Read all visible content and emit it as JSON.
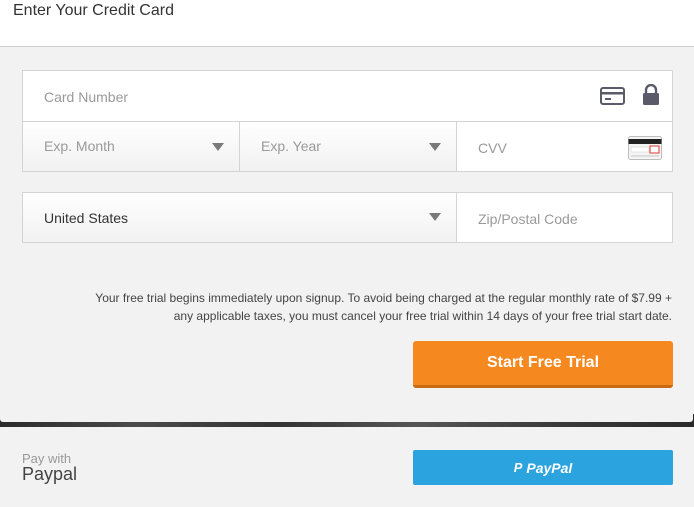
{
  "header": {
    "title": "Enter Your Credit Card"
  },
  "card_form": {
    "card_number": {
      "placeholder": "Card Number",
      "value": ""
    },
    "exp_month": {
      "placeholder": "Exp. Month"
    },
    "exp_year": {
      "placeholder": "Exp. Year"
    },
    "cvv": {
      "placeholder": "CVV",
      "value": ""
    },
    "country": {
      "selected": "United States"
    },
    "zip": {
      "placeholder": "Zip/Postal Code",
      "value": ""
    }
  },
  "notice": {
    "line1": "Your free trial begins immediately upon signup. To avoid being charged at the regular monthly rate of $7.99 +",
    "line2": "any applicable taxes, you must cancel your free trial within 14 days of your free trial start date."
  },
  "start_button": {
    "label": "Start Free Trial"
  },
  "paypal": {
    "pay_with": "Pay with",
    "label": "Paypal",
    "button_mark": "P",
    "button_label": "PayPal"
  },
  "colors": {
    "accent": "#f5891f",
    "paypal_blue": "#2aa3df",
    "panel_bg": "#f2f2f2"
  },
  "icons": [
    "credit-card-icon",
    "lock-icon",
    "cvv-card-icon",
    "chevron-down-icon",
    "paypal-logo-icon"
  ]
}
